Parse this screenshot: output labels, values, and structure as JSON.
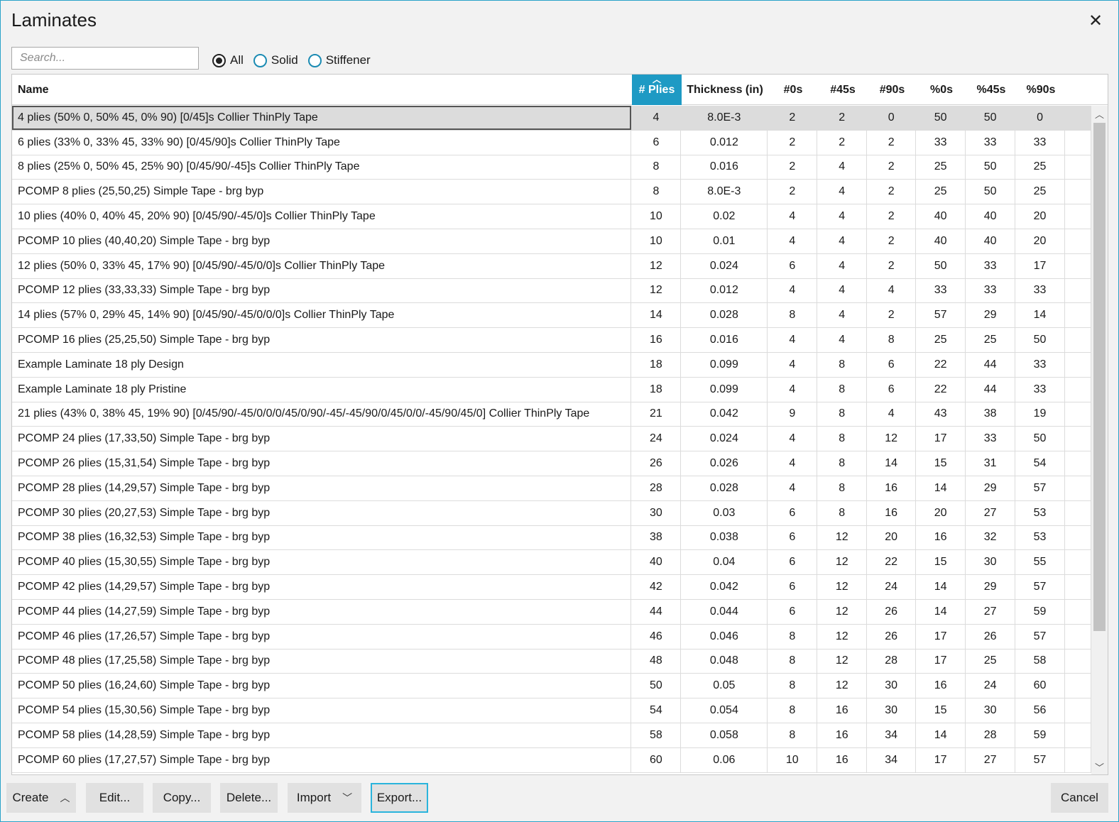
{
  "window": {
    "title": "Laminates",
    "close_glyph": "✕"
  },
  "search": {
    "placeholder": "Search..."
  },
  "filters": [
    {
      "label": "All",
      "checked": true
    },
    {
      "label": "Solid",
      "checked": false
    },
    {
      "label": "Stiffener",
      "checked": false
    }
  ],
  "columns": [
    "Name",
    "# Plies",
    "Thickness (in)",
    "#0s",
    "#45s",
    "#90s",
    "%0s",
    "%45s",
    "%90s"
  ],
  "sorted_column": "# Plies",
  "rows": [
    [
      "4 plies (50% 0, 50% 45, 0% 90) [0/45]s Collier ThinPly Tape",
      "4",
      "8.0E-3",
      "2",
      "2",
      "0",
      "50",
      "50",
      "0"
    ],
    [
      "6 plies (33% 0, 33% 45, 33% 90) [0/45/90]s Collier ThinPly Tape",
      "6",
      "0.012",
      "2",
      "2",
      "2",
      "33",
      "33",
      "33"
    ],
    [
      "8 plies (25% 0, 50% 45, 25% 90) [0/45/90/-45]s Collier ThinPly Tape",
      "8",
      "0.016",
      "2",
      "4",
      "2",
      "25",
      "50",
      "25"
    ],
    [
      "PCOMP 8 plies (25,50,25) Simple Tape - brg byp",
      "8",
      "8.0E-3",
      "2",
      "4",
      "2",
      "25",
      "50",
      "25"
    ],
    [
      "10 plies (40% 0, 40% 45, 20% 90) [0/45/90/-45/0]s Collier ThinPly Tape",
      "10",
      "0.02",
      "4",
      "4",
      "2",
      "40",
      "40",
      "20"
    ],
    [
      "PCOMP 10 plies (40,40,20) Simple Tape - brg byp",
      "10",
      "0.01",
      "4",
      "4",
      "2",
      "40",
      "40",
      "20"
    ],
    [
      "12 plies (50% 0, 33% 45, 17% 90) [0/45/90/-45/0/0]s Collier ThinPly Tape",
      "12",
      "0.024",
      "6",
      "4",
      "2",
      "50",
      "33",
      "17"
    ],
    [
      "PCOMP 12 plies (33,33,33) Simple Tape - brg byp",
      "12",
      "0.012",
      "4",
      "4",
      "4",
      "33",
      "33",
      "33"
    ],
    [
      "14 plies (57% 0, 29% 45, 14% 90) [0/45/90/-45/0/0/0]s Collier ThinPly Tape",
      "14",
      "0.028",
      "8",
      "4",
      "2",
      "57",
      "29",
      "14"
    ],
    [
      "PCOMP 16 plies (25,25,50) Simple Tape - brg byp",
      "16",
      "0.016",
      "4",
      "4",
      "8",
      "25",
      "25",
      "50"
    ],
    [
      "Example Laminate 18 ply Design",
      "18",
      "0.099",
      "4",
      "8",
      "6",
      "22",
      "44",
      "33"
    ],
    [
      "Example Laminate 18 ply Pristine",
      "18",
      "0.099",
      "4",
      "8",
      "6",
      "22",
      "44",
      "33"
    ],
    [
      "21 plies (43% 0, 38% 45, 19% 90) [0/45/90/-45/0/0/0/45/0/90/-45/-45/90/0/45/0/0/-45/90/45/0] Collier ThinPly Tape",
      "21",
      "0.042",
      "9",
      "8",
      "4",
      "43",
      "38",
      "19"
    ],
    [
      "PCOMP 24 plies (17,33,50) Simple Tape - brg byp",
      "24",
      "0.024",
      "4",
      "8",
      "12",
      "17",
      "33",
      "50"
    ],
    [
      "PCOMP 26 plies (15,31,54) Simple Tape - brg byp",
      "26",
      "0.026",
      "4",
      "8",
      "14",
      "15",
      "31",
      "54"
    ],
    [
      "PCOMP 28 plies (14,29,57) Simple Tape - brg byp",
      "28",
      "0.028",
      "4",
      "8",
      "16",
      "14",
      "29",
      "57"
    ],
    [
      "PCOMP 30 plies (20,27,53) Simple Tape - brg byp",
      "30",
      "0.03",
      "6",
      "8",
      "16",
      "20",
      "27",
      "53"
    ],
    [
      "PCOMP 38 plies (16,32,53) Simple Tape - brg byp",
      "38",
      "0.038",
      "6",
      "12",
      "20",
      "16",
      "32",
      "53"
    ],
    [
      "PCOMP 40 plies (15,30,55) Simple Tape - brg byp",
      "40",
      "0.04",
      "6",
      "12",
      "22",
      "15",
      "30",
      "55"
    ],
    [
      "PCOMP 42 plies (14,29,57) Simple Tape - brg byp",
      "42",
      "0.042",
      "6",
      "12",
      "24",
      "14",
      "29",
      "57"
    ],
    [
      "PCOMP 44 plies (14,27,59) Simple Tape - brg byp",
      "44",
      "0.044",
      "6",
      "12",
      "26",
      "14",
      "27",
      "59"
    ],
    [
      "PCOMP 46 plies (17,26,57) Simple Tape - brg byp",
      "46",
      "0.046",
      "8",
      "12",
      "26",
      "17",
      "26",
      "57"
    ],
    [
      "PCOMP 48 plies (17,25,58) Simple Tape - brg byp",
      "48",
      "0.048",
      "8",
      "12",
      "28",
      "17",
      "25",
      "58"
    ],
    [
      "PCOMP 50 plies (16,24,60) Simple Tape - brg byp",
      "50",
      "0.05",
      "8",
      "12",
      "30",
      "16",
      "24",
      "60"
    ],
    [
      "PCOMP 54 plies (15,30,56) Simple Tape - brg byp",
      "54",
      "0.054",
      "8",
      "16",
      "30",
      "15",
      "30",
      "56"
    ],
    [
      "PCOMP 58 plies (14,28,59) Simple Tape - brg byp",
      "58",
      "0.058",
      "8",
      "16",
      "34",
      "14",
      "28",
      "59"
    ],
    [
      "PCOMP 60 plies (17,27,57) Simple Tape - brg byp",
      "60",
      "0.06",
      "10",
      "16",
      "34",
      "17",
      "27",
      "57"
    ]
  ],
  "selected_row": 0,
  "buttons": {
    "create": "Create",
    "edit": "Edit...",
    "copy": "Copy...",
    "delete": "Delete...",
    "import": "Import",
    "export": "Export...",
    "cancel": "Cancel"
  },
  "icons": {
    "chevron_up": "chevron-up-icon",
    "chevron_down": "chevron-down-icon",
    "sort_ascending": "sort-ascending-icon"
  },
  "colors": {
    "accent": "#1e9ac4",
    "focus_border": "#2ab4dc",
    "selected_row": "#dcdcdc"
  }
}
